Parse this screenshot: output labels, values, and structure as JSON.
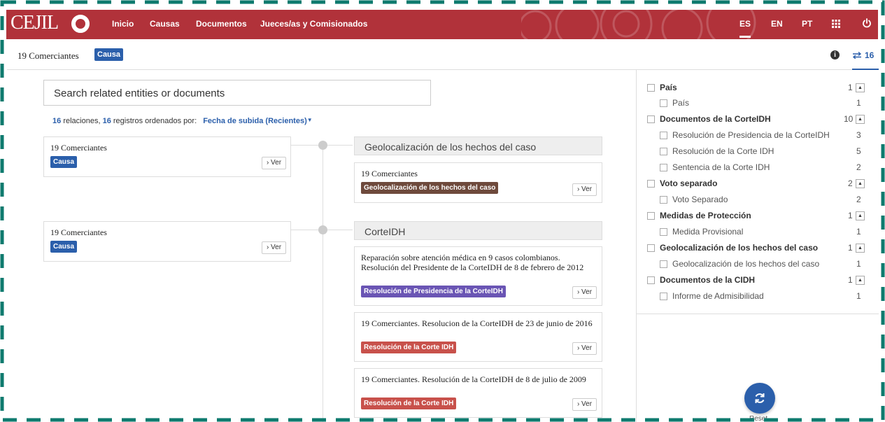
{
  "colors": {
    "brand": "#b1323a",
    "accent": "#2b5fab",
    "frame": "#0e7a6e"
  },
  "nav": {
    "logo": "CEJIL",
    "items": [
      "Inicio",
      "Causas",
      "Documentos",
      "Jueces/as y Comisionados"
    ],
    "languages": [
      "ES",
      "EN",
      "PT"
    ],
    "active_language": "ES",
    "icons": [
      "apps-grid-icon",
      "power-icon"
    ]
  },
  "header": {
    "title": "19 Comerciantes",
    "badge": "Causa",
    "info_icon": "info-icon",
    "relations_icon": "swap-arrows-icon",
    "relations_count": "16"
  },
  "search": {
    "placeholder": "Search related entities or documents"
  },
  "summary": {
    "relations": "16",
    "relations_label": "relaciones,",
    "records": "16",
    "records_label": "registros ordenados por:",
    "sort": "Fecha de subida (Recientes)"
  },
  "ver_label": "Ver",
  "left_cards": [
    {
      "title": "19 Comerciantes",
      "tag": "Causa"
    },
    {
      "title": "19 Comerciantes",
      "tag": "Causa"
    }
  ],
  "groups": [
    {
      "header": "Geolocalización de los hechos del caso",
      "cards": [
        {
          "title": "19 Comerciantes",
          "tag": "Geolocalización de los hechos del caso",
          "tag_color": "#6e4a3c"
        }
      ]
    },
    {
      "header": "CorteIDH",
      "cards": [
        {
          "title": "Reparación sobre atención médica en 9 casos colombianos. Resolución del Presidente de la CorteIDH de 8 de febrero de 2012",
          "tag": "Resolución de Presidencia de la CorteIDH",
          "tag_color": "#6a55b4"
        },
        {
          "title": "19 Comerciantes. Resolucion de la CorteIDH de 23 de junio de 2016",
          "tag": "Resolución de la Corte IDH",
          "tag_color": "#c8514b"
        },
        {
          "title": "19 Comerciantes. Resolución de la CorteIDH de 8 de julio de 2009",
          "tag": "Resolución de la Corte IDH",
          "tag_color": "#c8514b"
        }
      ]
    }
  ],
  "filters": [
    {
      "label": "País",
      "count": "1",
      "level": "parent"
    },
    {
      "label": "País",
      "count": "1",
      "level": "child"
    },
    {
      "label": "Documentos de la CorteIDH",
      "count": "10",
      "level": "parent"
    },
    {
      "label": "Resolución de Presidencia de la CorteIDH",
      "count": "3",
      "level": "child"
    },
    {
      "label": "Resolución de la Corte IDH",
      "count": "5",
      "level": "child"
    },
    {
      "label": "Sentencia de la Corte IDH",
      "count": "2",
      "level": "child"
    },
    {
      "label": "Voto separado",
      "count": "2",
      "level": "parent"
    },
    {
      "label": "Voto Separado",
      "count": "2",
      "level": "child"
    },
    {
      "label": "Medidas de Protección",
      "count": "1",
      "level": "parent"
    },
    {
      "label": "Medida Provisional",
      "count": "1",
      "level": "child"
    },
    {
      "label": "Geolocalización de los hechos del caso",
      "count": "1",
      "level": "parent"
    },
    {
      "label": "Geolocalización de los hechos del caso",
      "count": "1",
      "level": "child"
    },
    {
      "label": "Documentos de la CIDH",
      "count": "1",
      "level": "parent"
    },
    {
      "label": "Informe de Admisibilidad",
      "count": "1",
      "level": "child"
    }
  ],
  "reset": {
    "label": "Reset",
    "icon": "refresh-icon"
  }
}
